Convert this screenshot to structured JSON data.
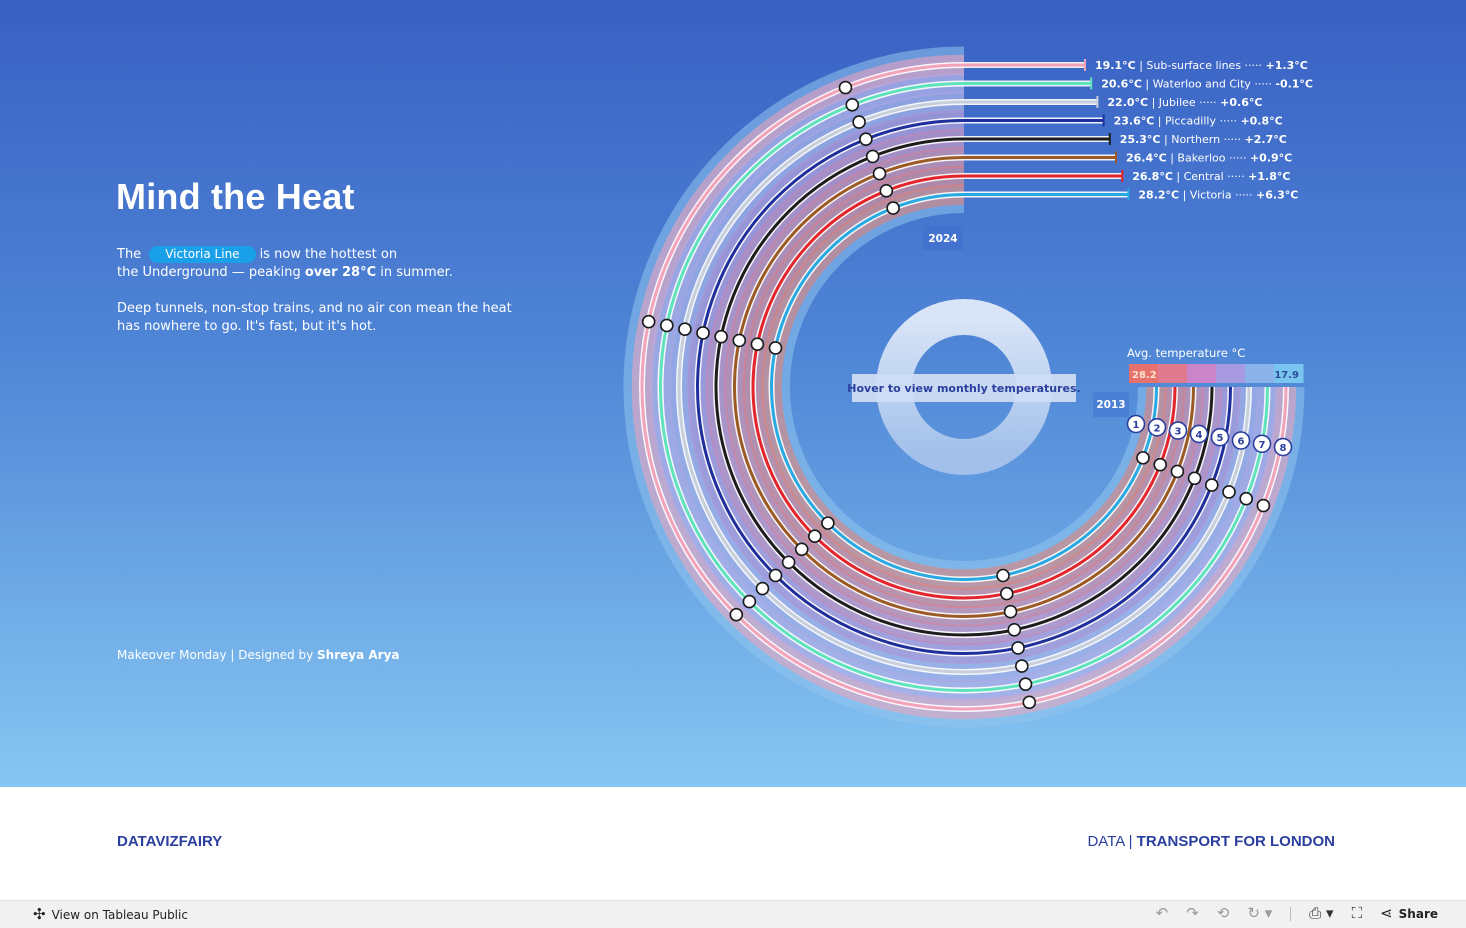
{
  "page": {
    "title": "Mind the Heat",
    "intro_pre": "The",
    "highlight_line": "Victoria Line",
    "intro_post": "is now the hottest on",
    "intro_line2_a": "the Underground — peaking",
    "intro_line2_b": "over 28°C",
    "intro_line2_c": "in summer.",
    "intro_p2": "Deep tunnels, non-stop trains, and no air con mean the heat has nowhere to go. It's fast, but it's hot.",
    "credit_pre": "Makeover Monday | Designed by",
    "credit_name": "Shreya Arya"
  },
  "footer": {
    "brand": "DATAVIZFAIRY",
    "source_pre": "DATA",
    "source_sep": "|",
    "source_name": "TRANSPORT FOR LONDON"
  },
  "toolbar": {
    "view_label": "View on Tableau Public",
    "share_label": "Share",
    "icons": [
      "undo-icon",
      "redo-icon",
      "revert-icon",
      "forward-icon",
      "download-icon",
      "fullscreen-icon",
      "share-icon"
    ]
  },
  "chart_data": {
    "type": "radial",
    "start_year": "2013",
    "end_year": "2024",
    "center_text": "Hover to view monthly temperatures.",
    "legend": {
      "title": "Avg. temperature °C",
      "max": 28.2,
      "min": 17.9,
      "colors": [
        "#e6716d",
        "#e07b8f",
        "#c985c8",
        "#a79ae0",
        "#8bb3ea",
        "#7ac5f0"
      ]
    },
    "series": [
      {
        "name": "Sub-surface lines",
        "value": "19.1°C",
        "change": "+1.3°C",
        "color": "#f2a3b9",
        "rank": "8"
      },
      {
        "name": "Waterloo and City",
        "value": "20.6°C",
        "change": "-0.1°C",
        "color": "#5fe3bd",
        "rank": "7"
      },
      {
        "name": "Jubilee",
        "value": "22.0°C",
        "change": "+0.6°C",
        "color": "#c7cfdb",
        "rank": "6"
      },
      {
        "name": "Piccadilly",
        "value": "23.6°C",
        "change": "+0.8°C",
        "color": "#1e2f9c",
        "rank": "5"
      },
      {
        "name": "Northern",
        "value": "25.3°C",
        "change": "+2.7°C",
        "color": "#1c1c1c",
        "rank": "4"
      },
      {
        "name": "Bakerloo",
        "value": "26.4°C",
        "change": "+0.9°C",
        "color": "#9b5a23",
        "rank": "3"
      },
      {
        "name": "Central",
        "value": "26.8°C",
        "change": "+1.8°C",
        "color": "#e3252b",
        "rank": "2"
      },
      {
        "name": "Victoria",
        "value": "28.2°C",
        "change": "+6.3°C",
        "color": "#27a9e1",
        "rank": "1"
      }
    ]
  }
}
